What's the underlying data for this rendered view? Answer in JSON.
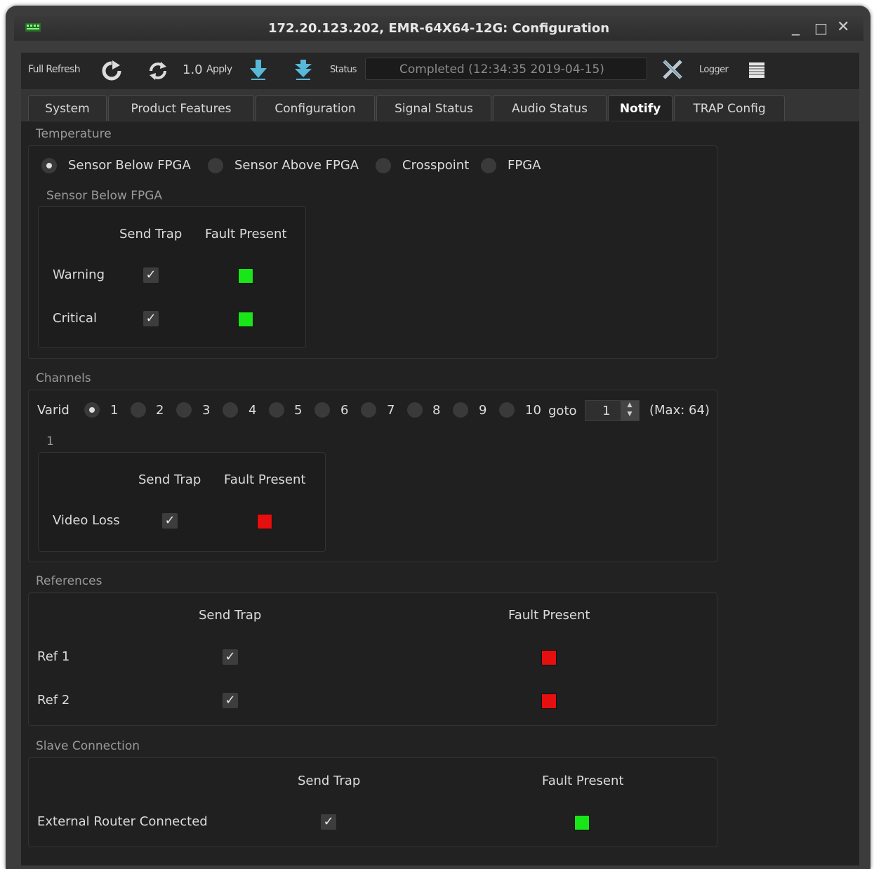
{
  "window": {
    "title": "172.20.123.202, EMR-64X64-12G: Configuration"
  },
  "toolbar": {
    "full_refresh": "Full Refresh",
    "rate": "1.0",
    "apply": "Apply",
    "status_label": "Status",
    "status_value": "Completed  (12:34:35 2019-04-15)",
    "logger": "Logger"
  },
  "tabs": [
    "System",
    "Product Features",
    "Configuration",
    "Signal Status",
    "Audio Status",
    "Notify",
    "TRAP Config"
  ],
  "active_tab": "Notify",
  "temperature": {
    "title": "Temperature",
    "options": [
      "Sensor Below FPGA",
      "Sensor Above FPGA",
      "Crosspoint",
      "FPGA"
    ],
    "selected": "Sensor Below FPGA",
    "sub_title": "Sensor Below FPGA",
    "col_send_trap": "Send Trap",
    "col_fault": "Fault Present",
    "rows": [
      {
        "label": "Warning",
        "send_trap": true,
        "fault": "green"
      },
      {
        "label": "Critical",
        "send_trap": true,
        "fault": "green"
      }
    ]
  },
  "channels": {
    "title": "Channels",
    "varid": "Varid",
    "numbers": [
      "1",
      "2",
      "3",
      "4",
      "5",
      "6",
      "7",
      "8",
      "9",
      "10"
    ],
    "selected": "1",
    "goto": "goto",
    "goto_value": "1",
    "max": "(Max: 64)",
    "sub_title": "1",
    "col_send_trap": "Send Trap",
    "col_fault": "Fault Present",
    "rows": [
      {
        "label": "Video Loss",
        "send_trap": true,
        "fault": "red"
      }
    ]
  },
  "references": {
    "title": "References",
    "col_send_trap": "Send Trap",
    "col_fault": "Fault Present",
    "rows": [
      {
        "label": "Ref 1",
        "send_trap": true,
        "fault": "red"
      },
      {
        "label": "Ref 2",
        "send_trap": true,
        "fault": "red"
      }
    ]
  },
  "slave": {
    "title": "Slave Connection",
    "col_send_trap": "Send Trap",
    "col_fault": "Fault Present",
    "rows": [
      {
        "label": "External Router Connected",
        "send_trap": true,
        "fault": "green"
      }
    ]
  },
  "colors": {
    "green": "#19e619",
    "red": "#e60f0f",
    "check_mark": "✓"
  }
}
